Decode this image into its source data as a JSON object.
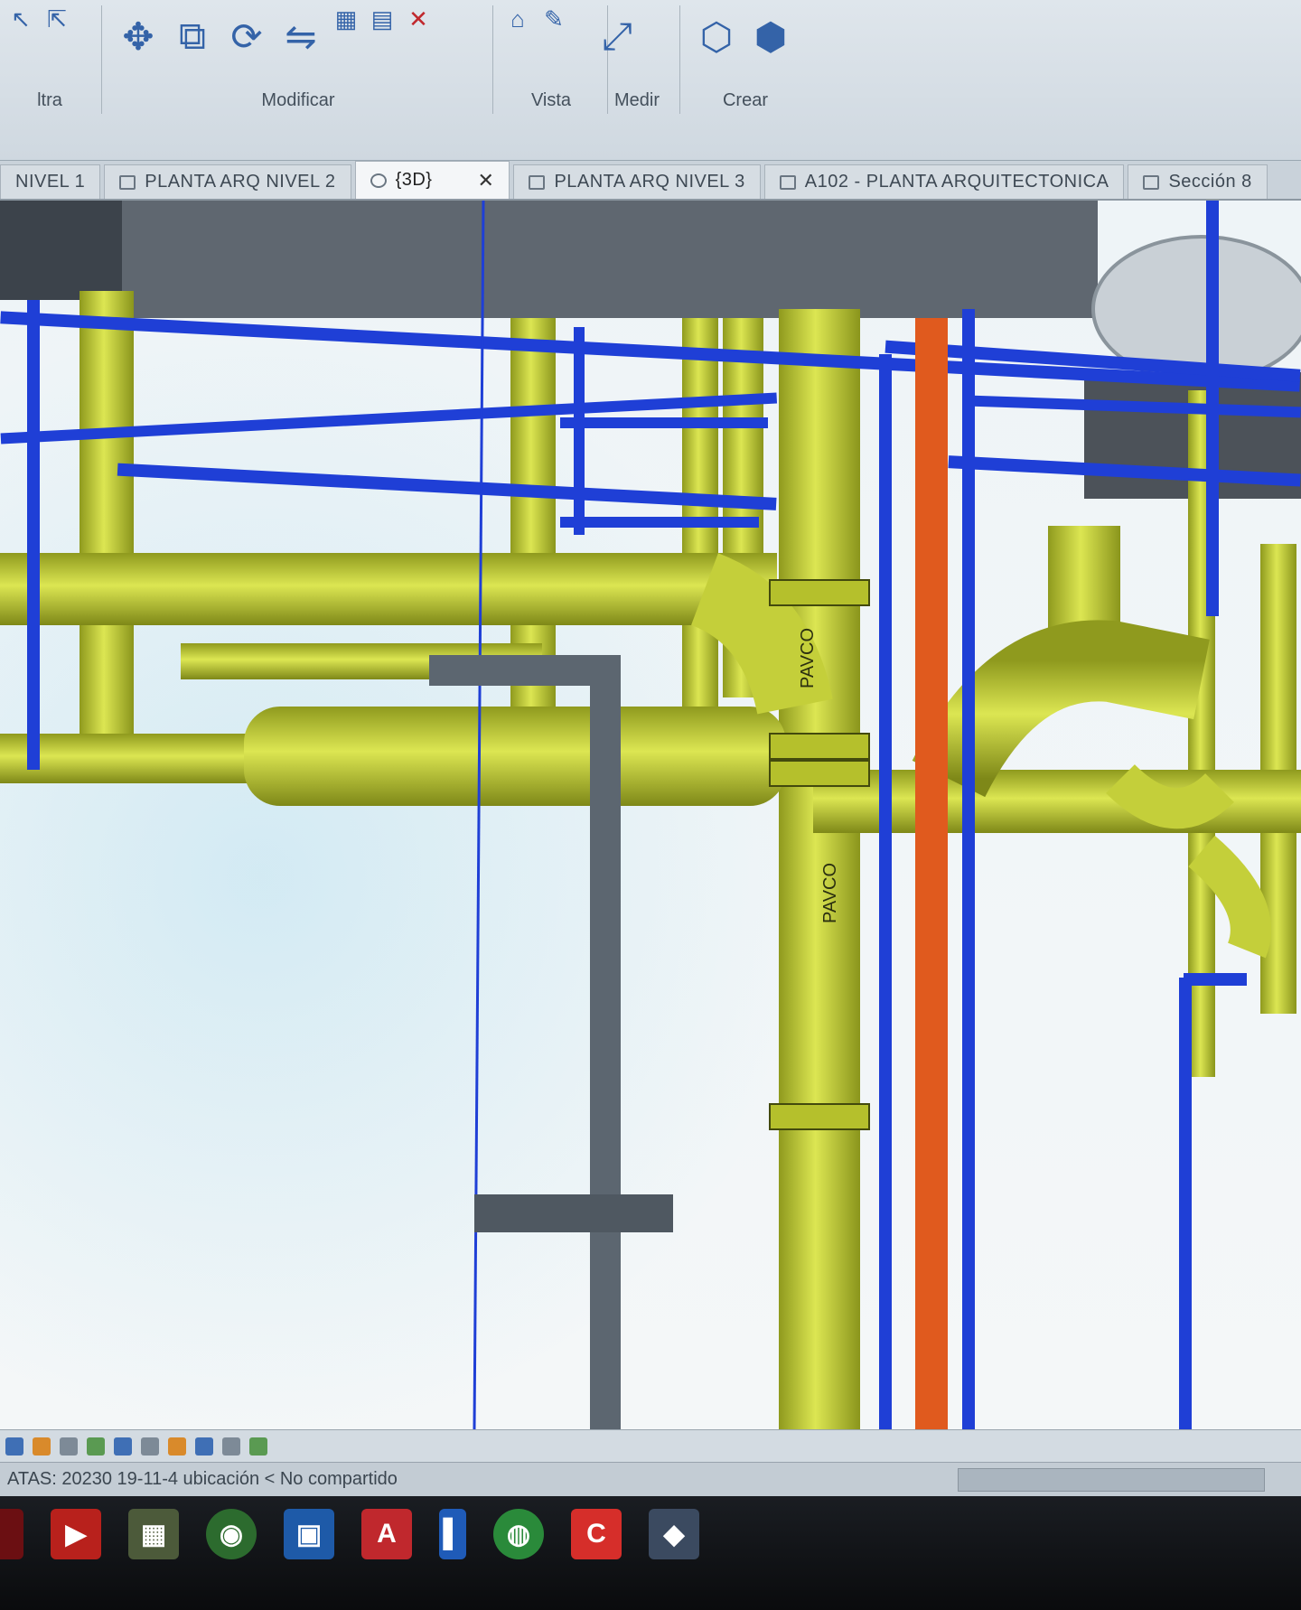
{
  "ribbon": {
    "groups": [
      {
        "label": "ltra"
      },
      {
        "label": "Modificar"
      },
      {
        "label": "Vista"
      },
      {
        "label": "Medir"
      },
      {
        "label": "Crear"
      }
    ]
  },
  "tabs": [
    {
      "label": "NIVEL 1"
    },
    {
      "label": "PLANTA ARQ NIVEL 2"
    },
    {
      "label": "{3D}",
      "active": true
    },
    {
      "label": "PLANTA ARQ NIVEL 3"
    },
    {
      "label": "A102 - PLANTA ARQUITECTONICA"
    },
    {
      "label": "Sección 8"
    }
  ],
  "viewport": {
    "pipe_labels": [
      "PAVCO",
      "PAVCO"
    ],
    "colors": {
      "sanitary_pipe": "#c9d43a",
      "water_pipe": "#1f3fd6",
      "hot_water_pipe": "#e05a1e",
      "slab": "#5f6770"
    }
  },
  "statusbar": {
    "text": "ATAS: 20230 19-11-4 ubicación < No compartido"
  },
  "taskbar": {
    "icons": [
      "acrobat-icon",
      "excel-icon",
      "chrome-icon",
      "outlook-icon",
      "autocad-icon",
      "word-icon",
      "whatsapp-icon",
      "revit-icon",
      "explorer-icon"
    ]
  }
}
